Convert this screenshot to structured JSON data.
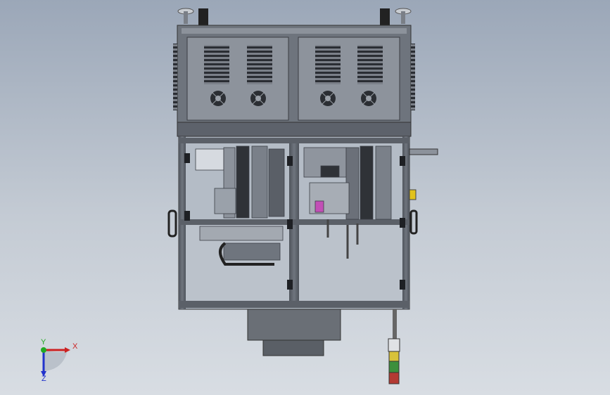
{
  "viewport": {
    "mode": "3d-cad-view",
    "background_top": "#9ba7b8",
    "background_bottom": "#d8dde3"
  },
  "model": {
    "frame_color": "#5f6570",
    "panel_color": "#8d939c",
    "glass_color": "#b7bec8",
    "cabinet_color": "#777d86",
    "base_block_color": "#6a6f76",
    "signal_tower_colors": [
      "#d8c23a",
      "#3c8f3c",
      "#b33a33"
    ]
  },
  "triad": {
    "x_label": "X",
    "y_label": "Y",
    "z_label": "Z",
    "x_color": "#cc2222",
    "y_color": "#22aa22",
    "z_color": "#2233cc"
  }
}
